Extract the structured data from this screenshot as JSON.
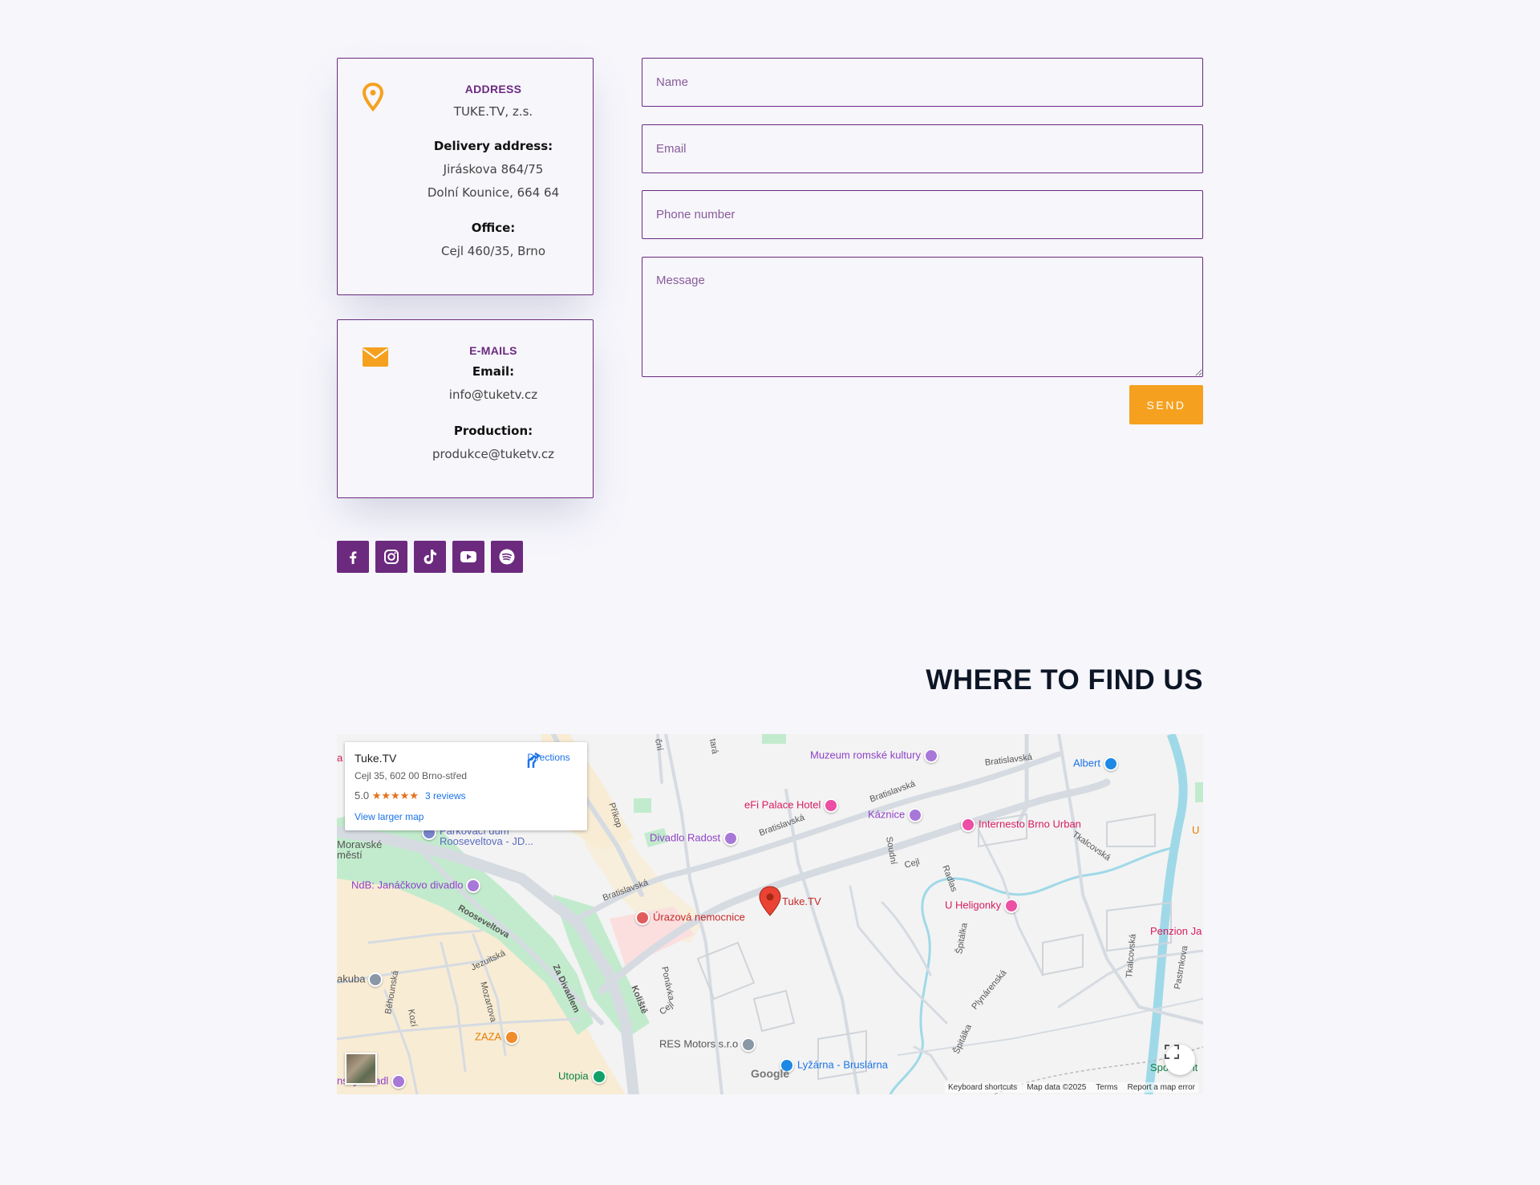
{
  "address_card": {
    "heading": "ADDRESS",
    "company": "TUKE.TV, z.s.",
    "delivery_label": "Delivery address:",
    "delivery_line1": "Jiráskova 864/75",
    "delivery_line2": "Dolní Kounice, 664 64",
    "office_label": "Office:",
    "office_line": "Cejl 460/35, Brno",
    "icon": "map-pin-icon"
  },
  "emails_card": {
    "heading": "E-MAILS",
    "email_label": "Email:",
    "email_value": "info@tuketv.cz",
    "production_label": "Production:",
    "production_value": "produkce@tuketv.cz",
    "icon": "envelope-icon"
  },
  "form": {
    "name_placeholder": "Name",
    "email_placeholder": "Email",
    "phone_placeholder": "Phone number",
    "message_placeholder": "Message",
    "send_label": "SEND"
  },
  "social": [
    "facebook-icon",
    "instagram-icon",
    "tiktok-icon",
    "youtube-icon",
    "spotify-icon"
  ],
  "find_us": {
    "title": "WHERE TO FIND US"
  },
  "map": {
    "place_name": "Tuke.TV",
    "place_address": "Cejl 35, 602 00 Brno-střed",
    "rating": "5.0",
    "stars": "★★★★★",
    "reviews": "3 reviews",
    "view_larger": "View larger map",
    "directions": "Directions",
    "marker_label": "Tuke.TV",
    "pois": {
      "muzeum": "Muzeum romské kultury",
      "albert": "Albert",
      "efi": "eFi Palace Hotel",
      "kaznice": "Káznice",
      "internesto": "Internesto Brno Urban",
      "divadlo_radost": "Divadlo Radost",
      "parkovaci_1": "Parkovací dům",
      "parkovaci_2": "Rooseveltova - JD...",
      "moravske_1": "Moravské",
      "moravske_2": "městí",
      "janackovo": "NdB: Janáčkovo divadlo",
      "urazova": "Úrazová nemocnice",
      "heligonky": "U Heligonky",
      "penzion": "Penzion Ja",
      "jakuba": "akuba",
      "zaza": "ZAZA",
      "res_motors": "RES Motors s.r.o",
      "lyzarna": "Lyžárna - Bruslárna",
      "utopia": "Utopia",
      "sp": "Spo",
      "ent": "ent",
      "u_edge": "U",
      "a_edge": "a",
      "divadlo_edge": "nský divadl"
    },
    "streets": {
      "bratislavska1": "Bratislavská",
      "bratislavska2": "Bratislavská",
      "bratislavska3": "Bratislavská",
      "bratislavska4": "Bratislavská",
      "prikop": "Příkop",
      "cejl1": "Cejl",
      "cejl2": "Cejl",
      "soudni": "Soudní",
      "radlas": "Radlas",
      "tkalcovska1": "Tkalcovská",
      "tkalcovska2": "Tkalcovská",
      "rooseveltova": "Rooseveltova",
      "jezuitska": "Jezuitská",
      "mozartova": "Mozartova",
      "za_divadlem": "Za Divadlem",
      "kolista": "Koliště",
      "ponavka": "Ponávka",
      "behounska": "Běhounská",
      "kozi": "Kozí",
      "spitalka1": "Špitálka",
      "spitalka2": "Špitálka",
      "plynarenska": "Plynárenská",
      "pastrnkova": "Pastrnkova",
      "cni": "ční",
      "tara": "tará"
    },
    "google": "Google",
    "attribution": {
      "shortcuts": "Keyboard shortcuts",
      "data": "Map data ©2025",
      "terms": "Terms",
      "report": "Report a map error"
    }
  },
  "colors": {
    "accent": "#6c2a7f",
    "orange": "#f5a11f",
    "bg": "#f6f6fb",
    "title": "#0d1626"
  }
}
